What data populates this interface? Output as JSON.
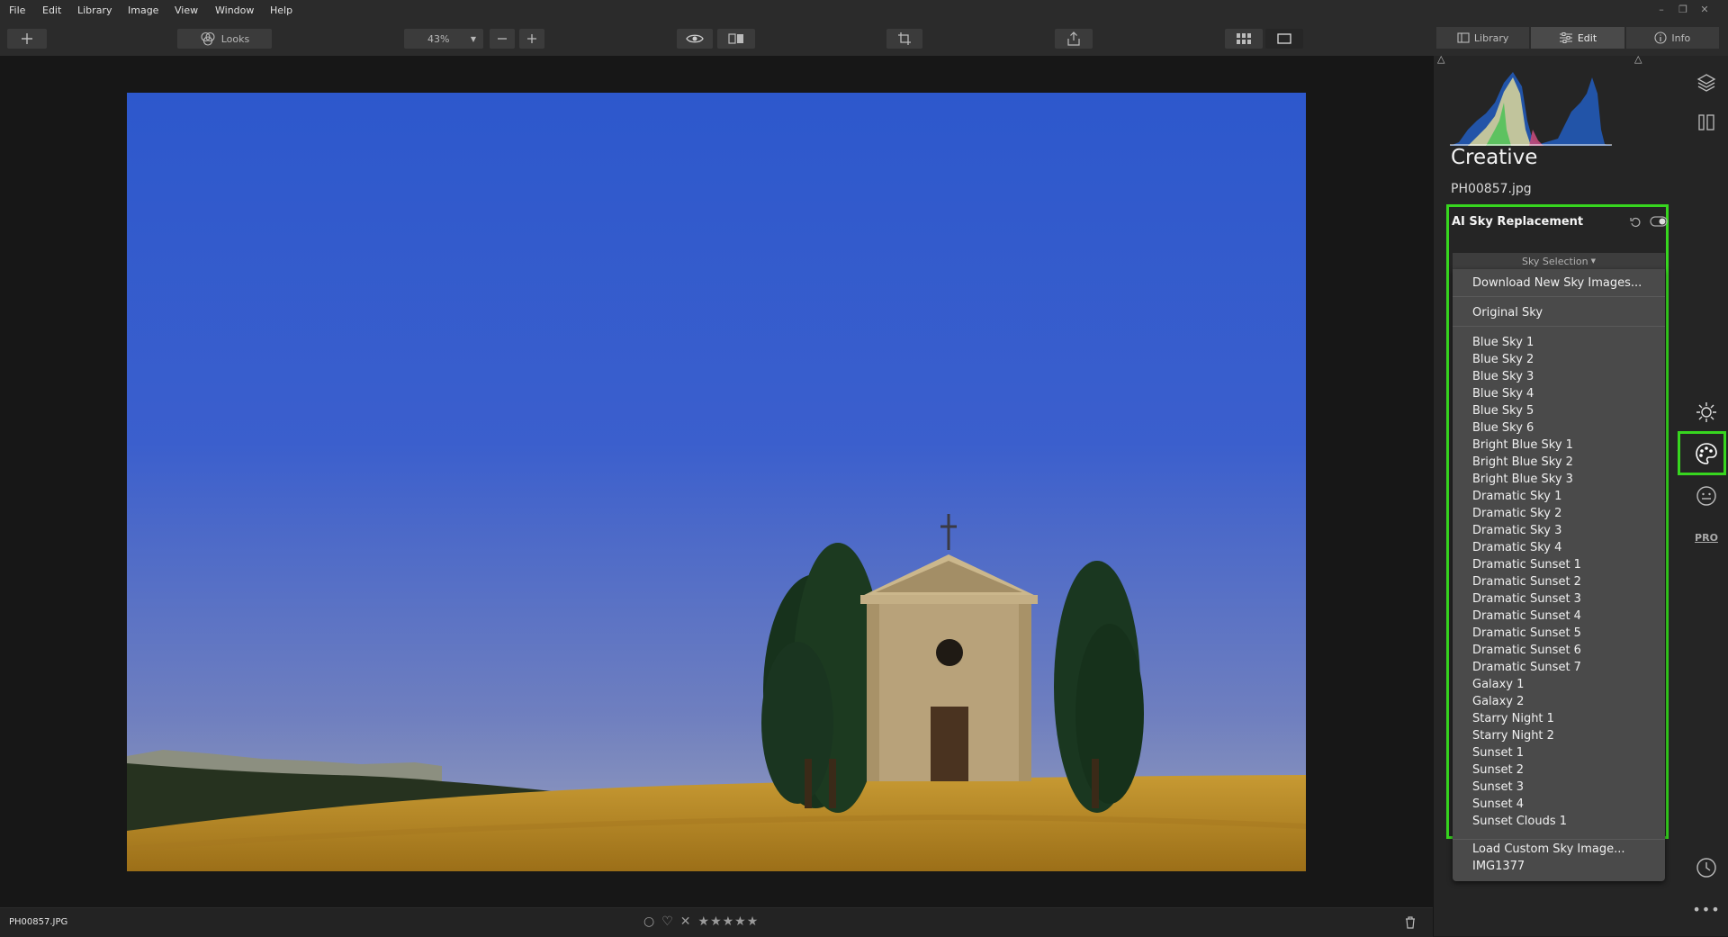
{
  "menubar": {
    "items": [
      "File",
      "Edit",
      "Library",
      "Image",
      "View",
      "Window",
      "Help"
    ]
  },
  "toolbar": {
    "looks_label": "Looks",
    "zoom_value": "43%"
  },
  "tabs": [
    {
      "label": "Library",
      "icon": "library-icon"
    },
    {
      "label": "Edit",
      "icon": "sliders-icon"
    },
    {
      "label": "Info",
      "icon": "info-icon"
    }
  ],
  "panel": {
    "title": "Creative",
    "file_name": "PH00857.jpg",
    "module_title": "AI Sky Replacement",
    "sky_selection_label": "Sky Selection",
    "menu": {
      "download": "Download New Sky Images...",
      "original": "Original Sky",
      "skies": [
        "Blue Sky 1",
        "Blue Sky 2",
        "Blue Sky 3",
        "Blue Sky 4",
        "Blue Sky 5",
        "Blue Sky 6",
        "Bright Blue Sky 1",
        "Bright Blue Sky 2",
        "Bright Blue Sky 3",
        "Dramatic Sky 1",
        "Dramatic Sky 2",
        "Dramatic Sky 3",
        "Dramatic Sky 4",
        "Dramatic Sunset 1",
        "Dramatic Sunset 2",
        "Dramatic Sunset 3",
        "Dramatic Sunset 4",
        "Dramatic Sunset 5",
        "Dramatic Sunset 6",
        "Dramatic Sunset 7",
        "Galaxy 1",
        "Galaxy 2",
        "Starry Night 1",
        "Starry Night 2",
        "Sunset 1",
        "Sunset 2",
        "Sunset 3",
        "Sunset 4",
        "Sunset Clouds 1"
      ],
      "load_custom": "Load Custom Sky Image...",
      "custom_image": "IMG1377"
    }
  },
  "rail": {
    "icons": [
      "layers-icon",
      "panels-icon",
      "sun-icon",
      "palette-icon",
      "face-icon",
      "pro-icon",
      "history-icon",
      "more-icon"
    ],
    "pro_label": "PRO"
  },
  "status": {
    "file_name": "PH00857.JPG"
  },
  "colors": {
    "highlight": "#37d61f",
    "panel_bg": "#252525",
    "menu_bg": "#4a4a4a"
  }
}
